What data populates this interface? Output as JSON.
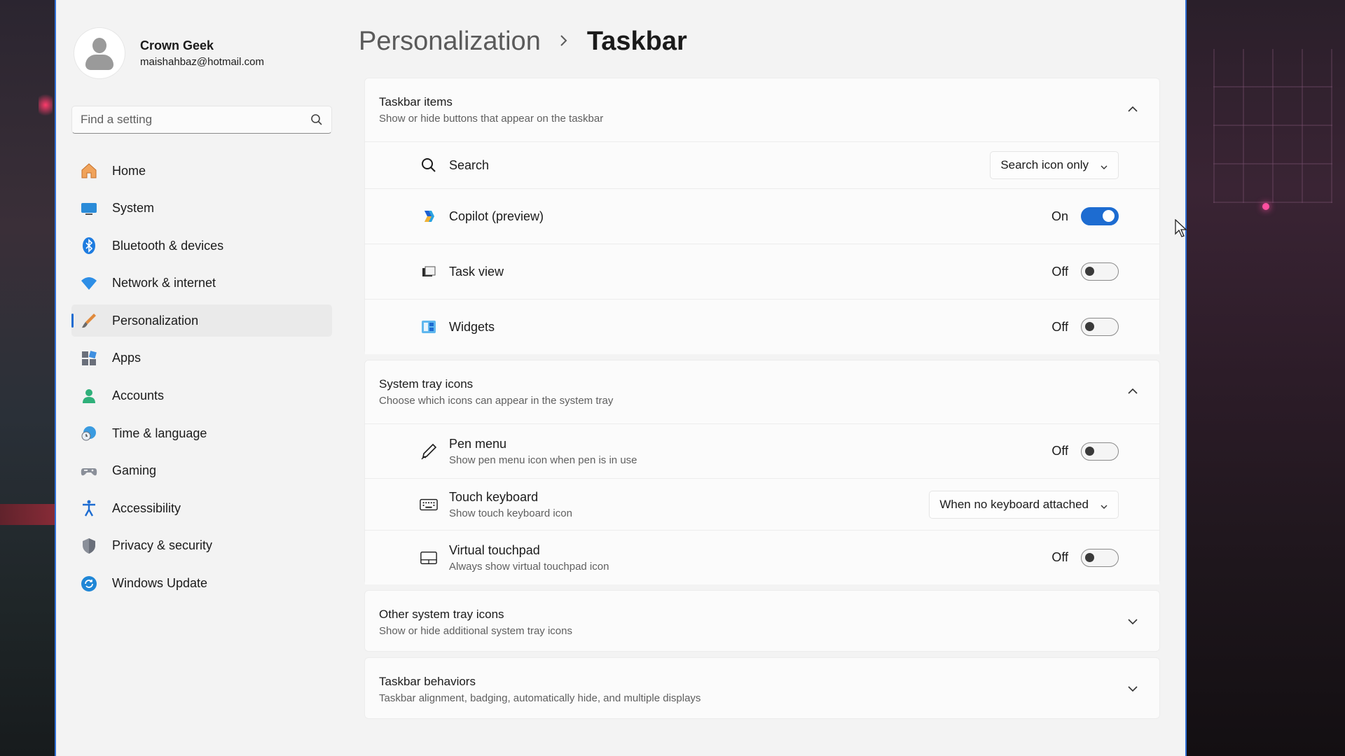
{
  "profile": {
    "name": "Crown Geek",
    "email": "maishahbaz@hotmail.com"
  },
  "search": {
    "placeholder": "Find a setting"
  },
  "sidebar": {
    "items": [
      {
        "label": "Home",
        "icon": "home-icon"
      },
      {
        "label": "System",
        "icon": "system-icon"
      },
      {
        "label": "Bluetooth & devices",
        "icon": "bluetooth-icon"
      },
      {
        "label": "Network & internet",
        "icon": "wifi-icon"
      },
      {
        "label": "Personalization",
        "icon": "brush-icon",
        "active": true
      },
      {
        "label": "Apps",
        "icon": "apps-icon"
      },
      {
        "label": "Accounts",
        "icon": "accounts-icon"
      },
      {
        "label": "Time & language",
        "icon": "globe-clock-icon"
      },
      {
        "label": "Gaming",
        "icon": "gamepad-icon"
      },
      {
        "label": "Accessibility",
        "icon": "accessibility-icon"
      },
      {
        "label": "Privacy & security",
        "icon": "shield-icon"
      },
      {
        "label": "Windows Update",
        "icon": "update-icon"
      }
    ]
  },
  "breadcrumb": {
    "parent": "Personalization",
    "current": "Taskbar"
  },
  "taskbar_items": {
    "title": "Taskbar items",
    "subtitle": "Show or hide buttons that appear on the taskbar",
    "search": {
      "label": "Search",
      "value": "Search icon only"
    },
    "copilot": {
      "label": "Copilot (preview)",
      "state": "On"
    },
    "taskview": {
      "label": "Task view",
      "state": "Off"
    },
    "widgets": {
      "label": "Widgets",
      "state": "Off"
    }
  },
  "system_tray": {
    "title": "System tray icons",
    "subtitle": "Choose which icons can appear in the system tray",
    "pen": {
      "label": "Pen menu",
      "desc": "Show pen menu icon when pen is in use",
      "state": "Off"
    },
    "touch_keyboard": {
      "label": "Touch keyboard",
      "desc": "Show touch keyboard icon",
      "value": "When no keyboard attached"
    },
    "touchpad": {
      "label": "Virtual touchpad",
      "desc": "Always show virtual touchpad icon",
      "state": "Off"
    }
  },
  "other_tray": {
    "title": "Other system tray icons",
    "subtitle": "Show or hide additional system tray icons"
  },
  "behaviors": {
    "title": "Taskbar behaviors",
    "subtitle": "Taskbar alignment, badging, automatically hide, and multiple displays"
  },
  "colors": {
    "accent": "#1d6cd1"
  }
}
